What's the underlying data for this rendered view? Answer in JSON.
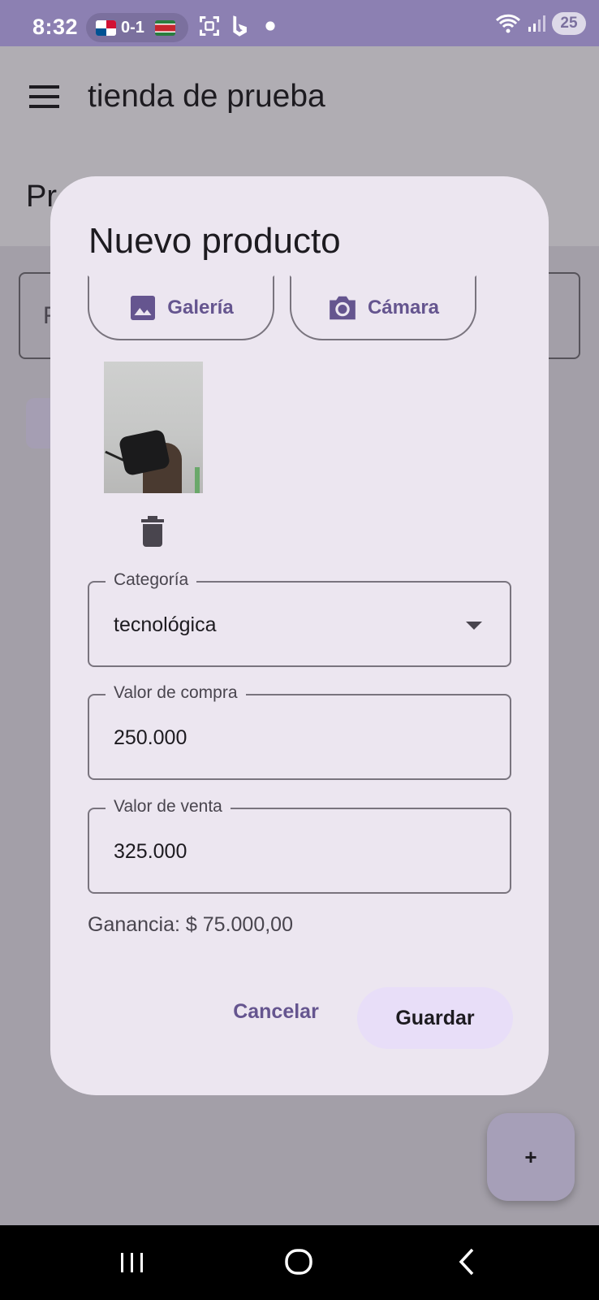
{
  "status_bar": {
    "time": "8:32",
    "score": "0-1",
    "battery": "25",
    "icons": [
      "panama-flag-icon",
      "suriname-flag-icon",
      "screenshot-icon",
      "bing-icon",
      "dot-icon",
      "wifi-icon",
      "signal-icon",
      "battery-icon"
    ]
  },
  "app_bar": {
    "title": "tienda de prueba"
  },
  "background": {
    "header_text_fragment": "Pr",
    "search_text_fragment": "F"
  },
  "fab": {
    "label": "+"
  },
  "dialog": {
    "title": "Nuevo producto",
    "gallery_button": "Galería",
    "camera_button": "Cámara",
    "category": {
      "label": "Categoría",
      "value": "tecnológica"
    },
    "purchase_value": {
      "label": "Valor de compra",
      "value": "250.000"
    },
    "sale_value": {
      "label": "Valor de venta",
      "value": "325.000"
    },
    "profit": "Ganancia: $ 75.000,00",
    "cancel_button": "Cancelar",
    "save_button": "Guardar"
  },
  "colors": {
    "status_bar": "#8c80b2",
    "dialog_bg": "#ece6f0",
    "accent": "#65558f",
    "save_button_bg": "#e8def8",
    "scrim": "#a39fa8"
  }
}
